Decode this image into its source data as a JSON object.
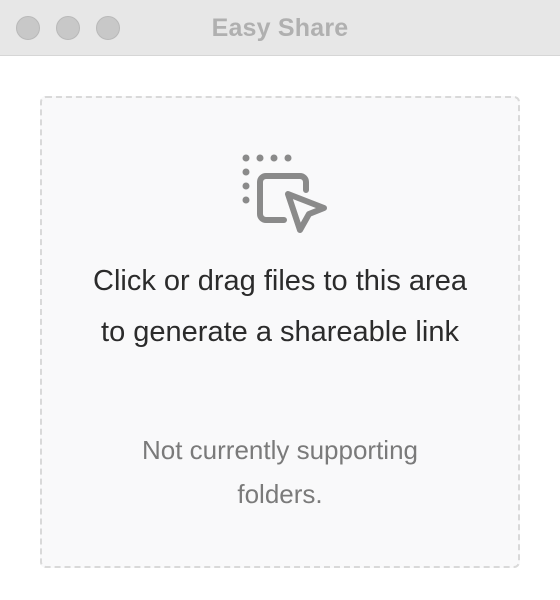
{
  "window": {
    "title": "Easy Share"
  },
  "dropzone": {
    "icon": "drag-select-icon",
    "primary_text": "Click or drag files to this area to generate a shareable link",
    "secondary_text": "Not currently supporting folders."
  },
  "colors": {
    "titlebar": "#e7e7e7",
    "dropzone_bg": "#f9f9fa",
    "dropzone_border": "#d9d9d9",
    "icon": "#8a8a8a"
  }
}
